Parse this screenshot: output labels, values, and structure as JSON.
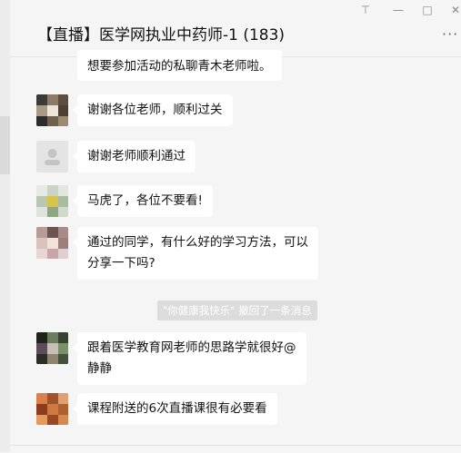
{
  "window": {
    "title": "【直播】医学网执业中药师-1 (183)",
    "pin_icon": "pin-icon",
    "minimize_icon": "minimize-icon",
    "maximize_icon": "maximize-icon",
    "close_icon": "close-icon",
    "more_label": "···"
  },
  "messages": [
    {
      "text": "想要参加活动的私聊青木老师啦。"
    },
    {
      "text": "谢谢各位老师，顺利过关"
    },
    {
      "text": "谢谢老师顺利通过"
    },
    {
      "text": "马虎了，各位不要看!"
    },
    {
      "line1": "通过的同学，有什么好的学习方法，可以",
      "line2": "分享一下吗?"
    },
    {
      "line1": "跟着医学教育网老师的思路学就很好@",
      "line2": "静静"
    },
    {
      "text": "课程附送的6次直播课很有必要看"
    }
  ],
  "system_notice": "\"你健康我快乐\" 撤回了一条消息",
  "colors": {
    "chat_bg": "#f5f5f5",
    "bubble_bg": "#ffffff",
    "system_bg": "#dcdcdc"
  }
}
